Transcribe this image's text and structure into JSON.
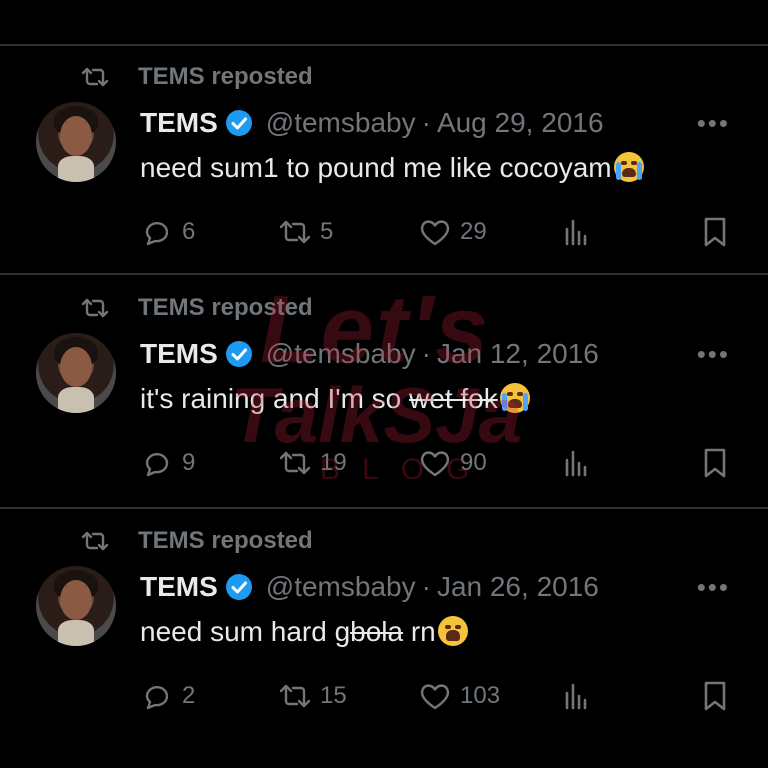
{
  "posts": [
    {
      "repost_label": "TEMS reposted",
      "name": "TEMS",
      "handle": "@temsbaby",
      "separator": "·",
      "date": "Aug 29, 2016",
      "more": "•••",
      "text_main": "need sum1 to pound me like cocoyam",
      "text_struck": "",
      "emoji": "loudly-crying-face",
      "replies": "6",
      "reposts": "5",
      "likes": "29"
    },
    {
      "repost_label": "TEMS reposted",
      "name": "TEMS",
      "handle": "@temsbaby",
      "separator": "·",
      "date": "Jan 12, 2016",
      "more": "•••",
      "text_main": "it's raining and I'm so ",
      "text_struck": "wet fok",
      "emoji": "loudly-crying-face",
      "replies": "9",
      "reposts": "19",
      "likes": "90"
    },
    {
      "repost_label": "TEMS reposted",
      "name": "TEMS",
      "handle": "@temsbaby",
      "separator": "·",
      "date": "Jan 26, 2016",
      "more": "•••",
      "text_main": "need sum hard g",
      "text_struck": "bola",
      "text_after": " rn",
      "emoji": "weary-face",
      "replies": "2",
      "reposts": "15",
      "likes": "103"
    }
  ],
  "watermark": {
    "line1": "Let's",
    "line2": "TalkSJa",
    "line3": "BLOG"
  },
  "colors": {
    "background": "#000000",
    "text": "#e7e9ea",
    "muted": "#71767b",
    "verified": "#1d9bf0",
    "divider": "#2f3336"
  }
}
